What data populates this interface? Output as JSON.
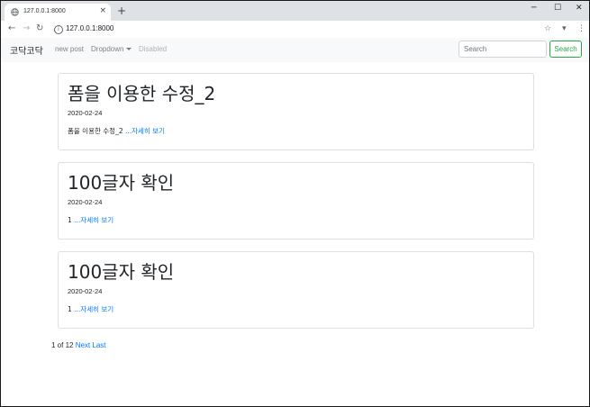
{
  "browser": {
    "tab_title": "127.0.0.1:8000",
    "tab_close": "×",
    "new_tab": "+",
    "url": "127.0.0.1:8000",
    "window_controls": {
      "minimize": "─",
      "maximize": "☐",
      "close": "✕"
    },
    "nav": {
      "back": "←",
      "forward": "→",
      "reload": "↻"
    },
    "toolbar_icons": {
      "bookmark": "☆",
      "extension": "▾",
      "menu": "⋮"
    }
  },
  "navbar": {
    "brand": "코닥코닥",
    "links": {
      "new_post": "new post",
      "dropdown": "Dropdown",
      "disabled": "Disabled"
    },
    "search": {
      "placeholder": "Search",
      "button": "Search"
    }
  },
  "posts": [
    {
      "title": "폼을 이용한 수정_2",
      "date": "2020-02-24",
      "excerpt": "폼을 이용한 수정_2 ",
      "more": "...자세히 보기"
    },
    {
      "title": "100글자 확인",
      "date": "2020-02-24",
      "excerpt": "1 ",
      "more": "...자세히 보기"
    },
    {
      "title": "100글자 확인",
      "date": "2020-02-24",
      "excerpt": "1 ",
      "more": "...자세히 보기"
    }
  ],
  "pagination": {
    "status": "1 of 12",
    "next": "Next",
    "last": "Last"
  },
  "colors": {
    "link": "#007bff",
    "success": "#28a745",
    "navbar_bg": "#f8f9fa"
  }
}
